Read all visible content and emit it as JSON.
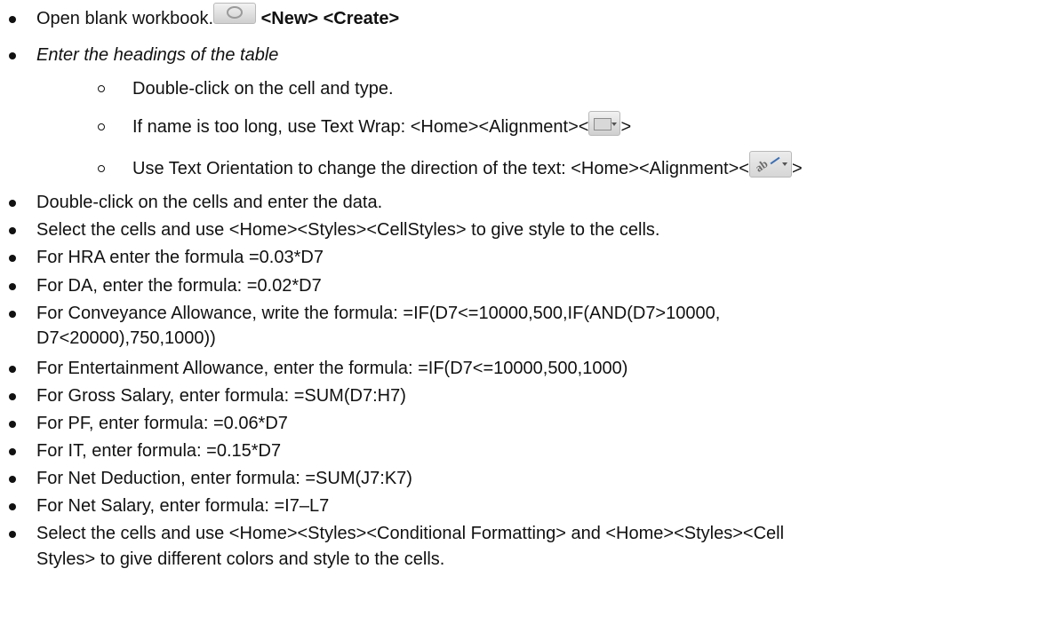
{
  "items": [
    {
      "pre": "Open blank workbook.",
      "bold": "<New> <Create>"
    },
    {
      "text": "Enter the headings of the table"
    },
    {
      "text": "Double-click on the cell and type."
    },
    {
      "pre": "If name is too long, use Text Wrap: <Home><Alignment><",
      "post": ">"
    },
    {
      "pre": "Use Text Orientation to change the direction of the text: <Home><Alignment><",
      "post": ">"
    },
    {
      "text": "Double-click on the cells and enter the data."
    },
    {
      "text": "Select the cells and use <Home><Styles><CellStyles> to give style to the cells."
    },
    {
      "text": "For HRA enter the formula =0.03*D7"
    },
    {
      "text": "For DA, enter the formula: =0.02*D7"
    },
    {
      "line1": "For Conveyance Allowance, write the formula: =IF(D7<=10000,500,IF(AND(D7>10000,",
      "line2": "D7<20000),750,1000))"
    },
    {
      "text": "For Entertainment Allowance, enter the formula: =IF(D7<=10000,500,1000)"
    },
    {
      "text": "For Gross Salary, enter formula: =SUM(D7:H7)"
    },
    {
      "text": "For PF, enter formula: =0.06*D7"
    },
    {
      "text": "For IT, enter formula: =0.15*D7"
    },
    {
      "text": "For Net Deduction, enter formula: =SUM(J7:K7)"
    },
    {
      "text": "For Net Salary, enter formula: =I7–L7"
    },
    {
      "line1": "Select the cells and use <Home><Styles><Conditional Formatting> and <Home><Styles><Cell",
      "line2": "Styles> to give different colors and style to the cells."
    }
  ],
  "icons": {
    "new": "new-workbook-icon",
    "wrap": "wrap-text-icon",
    "orientation": "text-orientation-icon"
  }
}
